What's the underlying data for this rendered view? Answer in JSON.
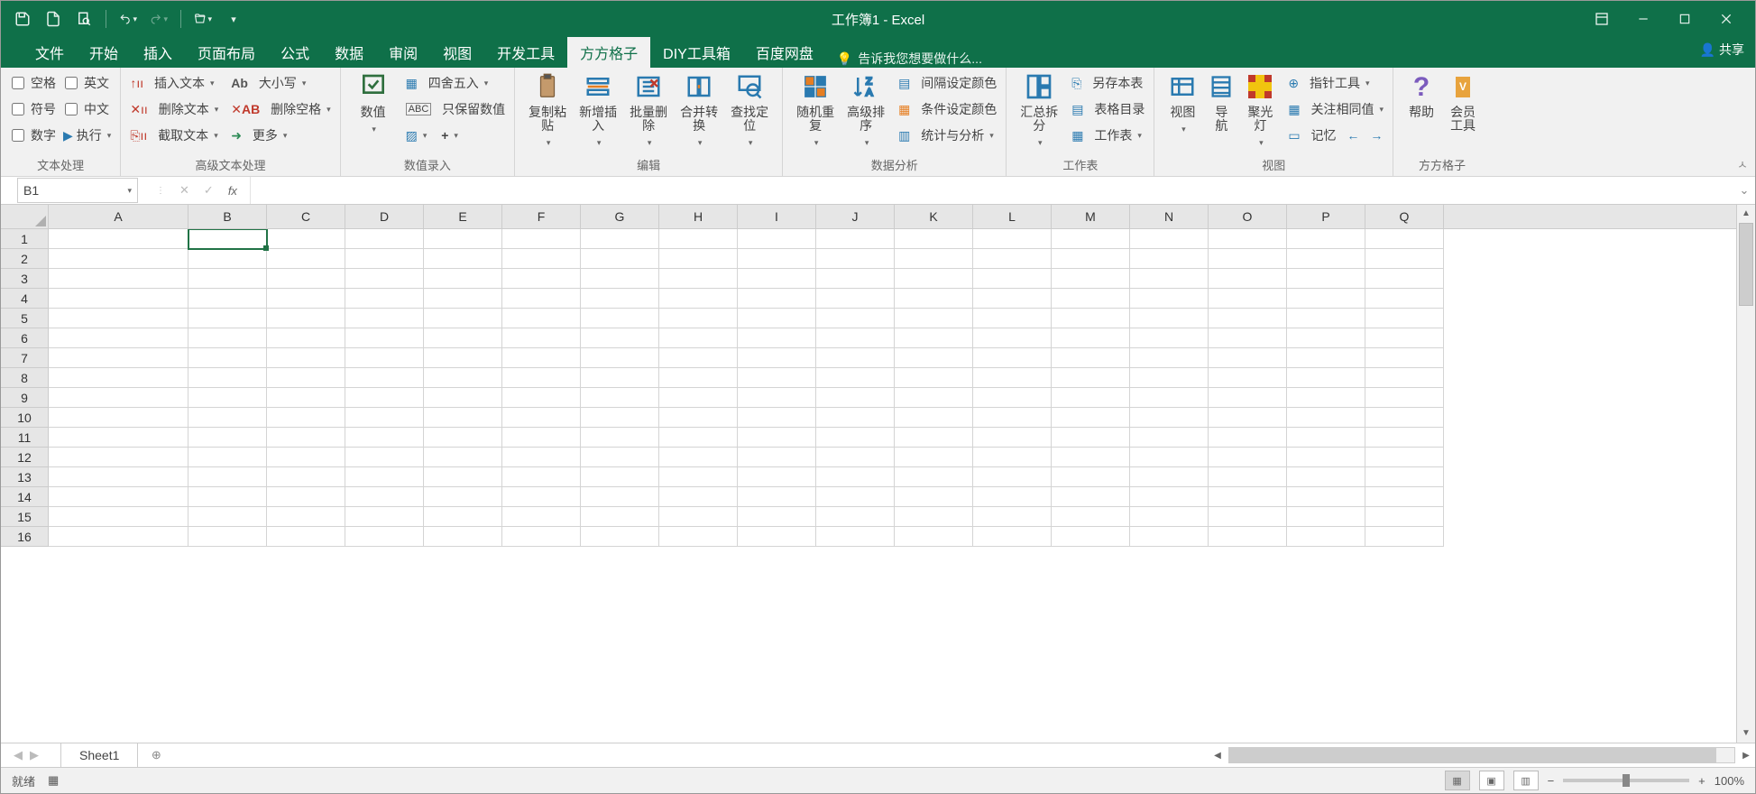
{
  "title": "工作簿1 - Excel",
  "qat": [
    "save",
    "new",
    "print-preview",
    "undo",
    "redo",
    "open"
  ],
  "win": {
    "ribbon_opts": "功能区显示选项",
    "min": "最小化",
    "max": "向下还原",
    "close": "关闭"
  },
  "tabs": [
    "文件",
    "开始",
    "插入",
    "页面布局",
    "公式",
    "数据",
    "审阅",
    "视图",
    "开发工具",
    "方方格子",
    "DIY工具箱",
    "百度网盘"
  ],
  "active_tab": "方方格子",
  "tellme": "告诉我您想要做什么...",
  "share": "共享",
  "groups": {
    "g1": {
      "label": "文本处理",
      "chk": [
        [
          "空格",
          "英文"
        ],
        [
          "符号",
          "中文"
        ],
        [
          "数字",
          ""
        ]
      ],
      "exec": "执行"
    },
    "g2": {
      "label": "高级文本处理",
      "items": [
        "插入文本",
        "删除文本",
        "截取文本",
        "大小写",
        "删除空格",
        "更多"
      ]
    },
    "g3": {
      "label": "数值录入",
      "big": "数值",
      "items": [
        "四舍五入",
        "只保留数值"
      ]
    },
    "g4": {
      "label": "编辑",
      "big": [
        "复制粘贴",
        "新增插入",
        "批量删除",
        "合并转换",
        "查找定位"
      ]
    },
    "g5": {
      "label": "数据分析",
      "big": [
        "随机重复",
        "高级排序"
      ],
      "items": [
        "间隔设定颜色",
        "条件设定颜色",
        "统计与分析"
      ]
    },
    "g6": {
      "label": "工作表",
      "big": "汇总拆分",
      "items": [
        "另存本表",
        "表格目录",
        "工作表"
      ]
    },
    "g7": {
      "label": "视图",
      "big": [
        "视图",
        "导航",
        "聚光灯"
      ],
      "items": [
        "指针工具",
        "关注相同值",
        "记忆"
      ]
    },
    "g8": {
      "label": "方方格子",
      "big": [
        "帮助",
        "会员工具"
      ]
    }
  },
  "namebox": "B1",
  "fx_label": "fx",
  "columns": [
    "A",
    "B",
    "C",
    "D",
    "E",
    "F",
    "G",
    "H",
    "I",
    "J",
    "K",
    "L",
    "M",
    "N",
    "O",
    "P",
    "Q"
  ],
  "rows": [
    1,
    2,
    3,
    4,
    5,
    6,
    7,
    8,
    9,
    10,
    11,
    12,
    13,
    14,
    15,
    16
  ],
  "selected": {
    "row": 1,
    "col": "B"
  },
  "sheet": "Sheet1",
  "status": "就绪",
  "zoom": "100%"
}
